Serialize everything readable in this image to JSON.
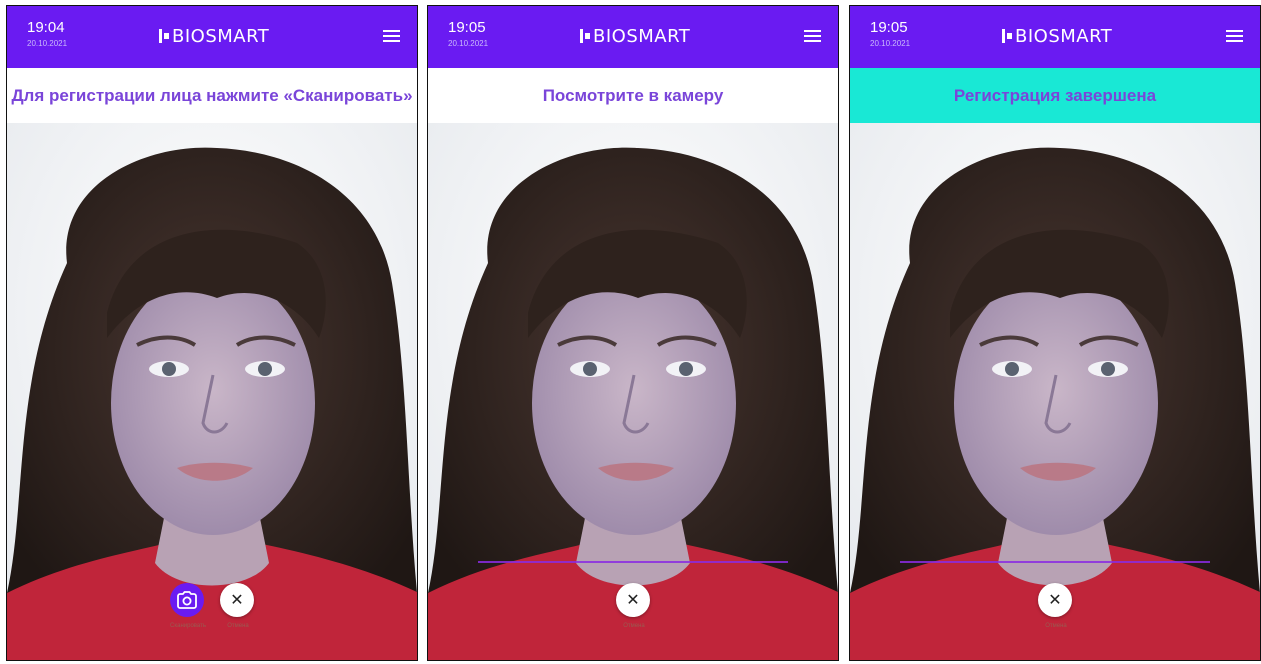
{
  "app": {
    "logo_text": "BIOSMART"
  },
  "screens": [
    {
      "time": "19:04",
      "date": "20.10.2021",
      "message": "Для регистрации лица нажмите «Сканировать»",
      "scan_label": "Сканировать",
      "cancel_label": "Отмена"
    },
    {
      "time": "19:05",
      "date": "20.10.2021",
      "message": "Посмотрите в камеру",
      "cancel_label": "Отмена"
    },
    {
      "time": "19:05",
      "date": "20.10.2021",
      "message": "Регистрация завершена",
      "cancel_label": "Отмена"
    }
  ],
  "icons": {
    "menu": "hamburger-icon",
    "scan": "camera-icon",
    "cancel": "close-icon"
  },
  "colors": {
    "header": "#6a1bf2",
    "banner_text": "#7a45d9",
    "success_banner": "#19e8d5",
    "scan_line": "#8a2be2"
  }
}
